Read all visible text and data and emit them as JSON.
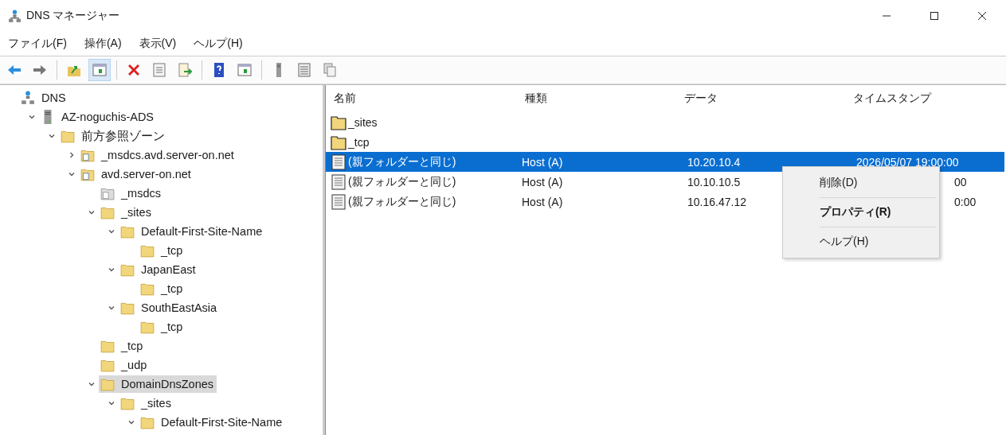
{
  "window": {
    "title": "DNS マネージャー"
  },
  "menu_bar": [
    "ファイル(F)",
    "操作(A)",
    "表示(V)",
    "ヘルプ(H)"
  ],
  "toolbar": [
    {
      "kind": "back",
      "pressed": false
    },
    {
      "kind": "forward",
      "pressed": false
    },
    {
      "kind": "sep"
    },
    {
      "kind": "up",
      "pressed": false
    },
    {
      "kind": "tree",
      "pressed": true
    },
    {
      "kind": "sep"
    },
    {
      "kind": "delete",
      "pressed": false
    },
    {
      "kind": "properties",
      "pressed": false
    },
    {
      "kind": "export",
      "pressed": false
    },
    {
      "kind": "sep"
    },
    {
      "kind": "help",
      "pressed": false
    },
    {
      "kind": "panel",
      "pressed": false
    },
    {
      "kind": "sep"
    },
    {
      "kind": "server",
      "pressed": false
    },
    {
      "kind": "list",
      "pressed": false
    },
    {
      "kind": "copy",
      "pressed": false
    }
  ],
  "tree": [
    {
      "label": "DNS",
      "kind": "dns",
      "selected": false,
      "children": [
        {
          "label": "AZ-noguchis-ADS",
          "kind": "server",
          "expanded": true,
          "selected": false,
          "children": [
            {
              "label": "前方参照ゾーン",
              "kind": "folder",
              "expanded": true,
              "selected": false,
              "children": [
                {
                  "label": "_msdcs.avd.server-on.net",
                  "kind": "zone",
                  "expanded": false,
                  "selected": false
                },
                {
                  "label": "avd.server-on.net",
                  "kind": "zone",
                  "expanded": true,
                  "selected": false,
                  "children": [
                    {
                      "label": "_msdcs",
                      "kind": "zone-gray",
                      "selected": false
                    },
                    {
                      "label": "_sites",
                      "kind": "folder",
                      "expanded": true,
                      "selected": false,
                      "children": [
                        {
                          "label": "Default-First-Site-Name",
                          "kind": "folder",
                          "expanded": true,
                          "selected": false,
                          "children": [
                            {
                              "label": "_tcp",
                              "kind": "folder",
                              "selected": false
                            }
                          ]
                        },
                        {
                          "label": "JapanEast",
                          "kind": "folder",
                          "expanded": true,
                          "selected": false,
                          "children": [
                            {
                              "label": "_tcp",
                              "kind": "folder",
                              "selected": false
                            }
                          ]
                        },
                        {
                          "label": "SouthEastAsia",
                          "kind": "folder",
                          "expanded": true,
                          "selected": false,
                          "children": [
                            {
                              "label": "_tcp",
                              "kind": "folder",
                              "selected": false
                            }
                          ]
                        }
                      ]
                    },
                    {
                      "label": "_tcp",
                      "kind": "folder",
                      "selected": false
                    },
                    {
                      "label": "_udp",
                      "kind": "folder",
                      "selected": false
                    },
                    {
                      "label": "DomainDnsZones",
                      "kind": "folder",
                      "expanded": true,
                      "selected": true,
                      "children": [
                        {
                          "label": "_sites",
                          "kind": "folder",
                          "expanded": true,
                          "selected": false,
                          "children": [
                            {
                              "label": "Default-First-Site-Name",
                              "kind": "folder",
                              "expanded": true,
                              "selected": false
                            }
                          ]
                        }
                      ]
                    }
                  ]
                }
              ]
            }
          ]
        }
      ]
    }
  ],
  "list": {
    "columns": [
      "名前",
      "種類",
      "データ",
      "タイムスタンプ"
    ],
    "rows": [
      {
        "kind": "folder",
        "name": "_sites",
        "selected": false
      },
      {
        "kind": "folder",
        "name": "_tcp",
        "selected": false
      },
      {
        "kind": "record",
        "name": "(親フォルダーと同じ)",
        "type": "Host (A)",
        "data": "10.20.10.4",
        "timestamp": "2026/05/07 19:00:00",
        "selected": true
      },
      {
        "kind": "record",
        "name": "(親フォルダーと同じ)",
        "type": "Host (A)",
        "data": "10.10.10.5",
        "timestamp_tail": "00",
        "selected": false
      },
      {
        "kind": "record",
        "name": "(親フォルダーと同じ)",
        "type": "Host (A)",
        "data": "10.16.47.12",
        "timestamp_tail": "0:00",
        "selected": false
      }
    ]
  },
  "context_menu": [
    {
      "label": "削除(D)",
      "default": false
    },
    {
      "label": "プロパティ(R)",
      "default": true
    },
    {
      "label": "ヘルプ(H)",
      "default": false
    }
  ]
}
